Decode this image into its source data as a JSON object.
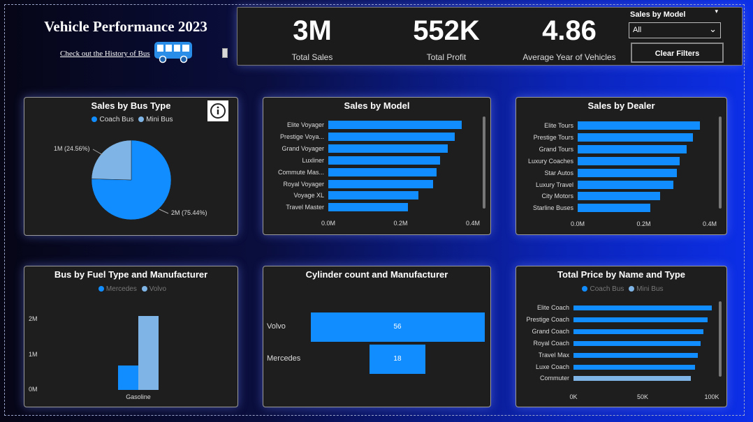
{
  "header": {
    "title": "Vehicle Performance 2023",
    "history_link": "Check out the History of Bus"
  },
  "kpis": [
    {
      "value": "3M",
      "label": "Total Sales"
    },
    {
      "value": "552K",
      "label": "Total Profit"
    },
    {
      "value": "4.86",
      "label": "Average Year of Vehicles"
    }
  ],
  "filter": {
    "label": "Sales by Model",
    "selected": "All",
    "clear_label": "Clear Filters"
  },
  "colors": {
    "primary": "#118dff",
    "secondary": "#7fb5e6",
    "panel": "#1e1e1e"
  },
  "chart_data": [
    {
      "type": "pie",
      "title": "Sales by Bus Type",
      "legend": "top",
      "series": [
        {
          "name": "Coach Bus",
          "value": 75.44,
          "label": "2M (75.44%)",
          "color": "#118dff"
        },
        {
          "name": "Mini Bus",
          "value": 24.56,
          "label": "1M (24.56%)",
          "color": "#7fb5e6"
        }
      ]
    },
    {
      "type": "bar",
      "title": "Sales by Model",
      "categories": [
        "Elite Voyager",
        "Prestige Voya...",
        "Grand Voyager",
        "Luxliner",
        "Commute Mas...",
        "Royal Voyager",
        "Voyage XL",
        "Travel Master"
      ],
      "values": [
        0.37,
        0.35,
        0.33,
        0.31,
        0.3,
        0.29,
        0.25,
        0.22
      ],
      "xticks": [
        "0.0M",
        "0.2M",
        "0.4M"
      ],
      "xlim": [
        0,
        0.4
      ]
    },
    {
      "type": "bar",
      "title": "Sales by Dealer",
      "categories": [
        "Elite Tours",
        "Prestige Tours",
        "Grand Tours",
        "Luxury Coaches",
        "Star Autos",
        "Luxury Travel",
        "City Motors",
        "Starline Buses"
      ],
      "values": [
        0.37,
        0.35,
        0.33,
        0.31,
        0.3,
        0.29,
        0.25,
        0.22
      ],
      "xticks": [
        "0.0M",
        "0.2M",
        "0.4M"
      ],
      "xlim": [
        0,
        0.4
      ]
    },
    {
      "type": "bar",
      "title": "Bus by Fuel Type and Manufacturer",
      "categories": [
        "Gasoline"
      ],
      "series": [
        {
          "name": "Mercedes",
          "values": [
            0.7
          ],
          "color": "#118dff"
        },
        {
          "name": "Volvo",
          "values": [
            2.1
          ],
          "color": "#7fb5e6"
        }
      ],
      "yticks": [
        "0M",
        "1M",
        "2M"
      ],
      "ylim": [
        0,
        2.2
      ]
    },
    {
      "type": "bar",
      "title": "Cylinder count and Manufacturer",
      "categories": [
        "Volvo",
        "Mercedes"
      ],
      "values": [
        56,
        18
      ]
    },
    {
      "type": "bar",
      "title": "Total Price by Name and Type",
      "legend_items": [
        {
          "name": "Coach Bus",
          "color": "#118dff"
        },
        {
          "name": "Mini Bus",
          "color": "#7fb5e6"
        }
      ],
      "categories": [
        "Elite Coach",
        "Prestige Coach",
        "Grand Coach",
        "Royal Coach",
        "Travel Max",
        "Luxe Coach",
        "Commuter"
      ],
      "values": [
        100,
        97,
        94,
        92,
        90,
        88,
        85
      ],
      "types": [
        "Coach Bus",
        "Coach Bus",
        "Coach Bus",
        "Coach Bus",
        "Coach Bus",
        "Coach Bus",
        "Mini Bus"
      ],
      "xticks": [
        "0K",
        "50K",
        "100K"
      ],
      "xlim": [
        0,
        100
      ]
    }
  ]
}
